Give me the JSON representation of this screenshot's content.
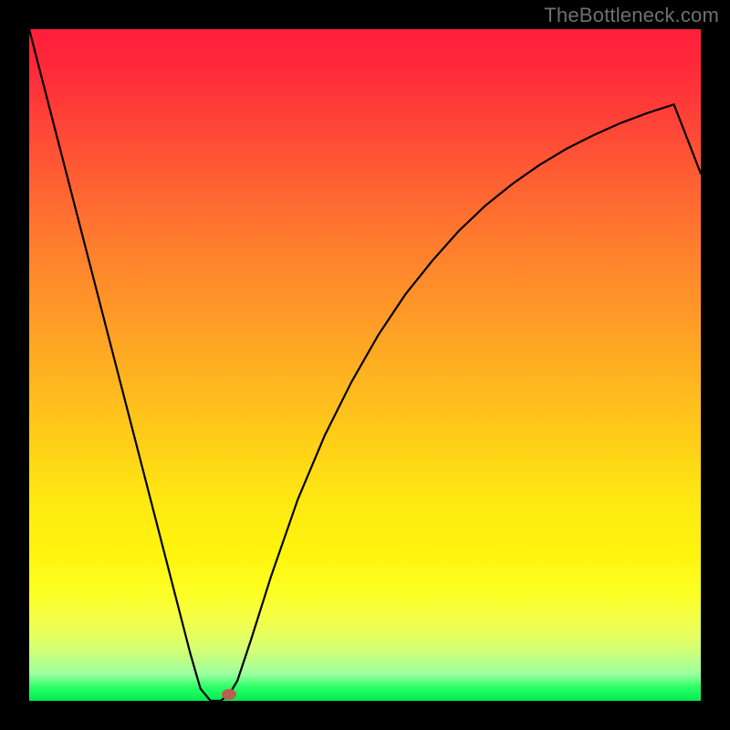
{
  "watermark": {
    "text": "TheBottleneck.com"
  },
  "chart_data": {
    "type": "line",
    "title": "",
    "xlabel": "",
    "ylabel": "",
    "x_range": [
      0,
      1
    ],
    "y_range": [
      0,
      1
    ],
    "grid": false,
    "legend": false,
    "background": "rainbow-vertical-red-to-green",
    "series": [
      {
        "name": "bottleneck-curve",
        "color": "#000000",
        "x": [
          0.0,
          0.04,
          0.08,
          0.12,
          0.16,
          0.2,
          0.24,
          0.255,
          0.27,
          0.285,
          0.298,
          0.31,
          0.33,
          0.36,
          0.4,
          0.44,
          0.48,
          0.52,
          0.56,
          0.6,
          0.64,
          0.68,
          0.72,
          0.76,
          0.8,
          0.84,
          0.88,
          0.92,
          0.96,
          1.0
        ],
        "y": [
          1.0,
          0.845,
          0.69,
          0.535,
          0.38,
          0.225,
          0.07,
          0.018,
          0.0,
          0.0,
          0.01,
          0.03,
          0.09,
          0.185,
          0.3,
          0.395,
          0.475,
          0.545,
          0.605,
          0.655,
          0.7,
          0.738,
          0.77,
          0.798,
          0.822,
          0.842,
          0.86,
          0.875,
          0.888,
          0.785
        ]
      }
    ],
    "marker": {
      "x": 0.298,
      "y": 0.01,
      "color": "#ba5f56"
    }
  }
}
